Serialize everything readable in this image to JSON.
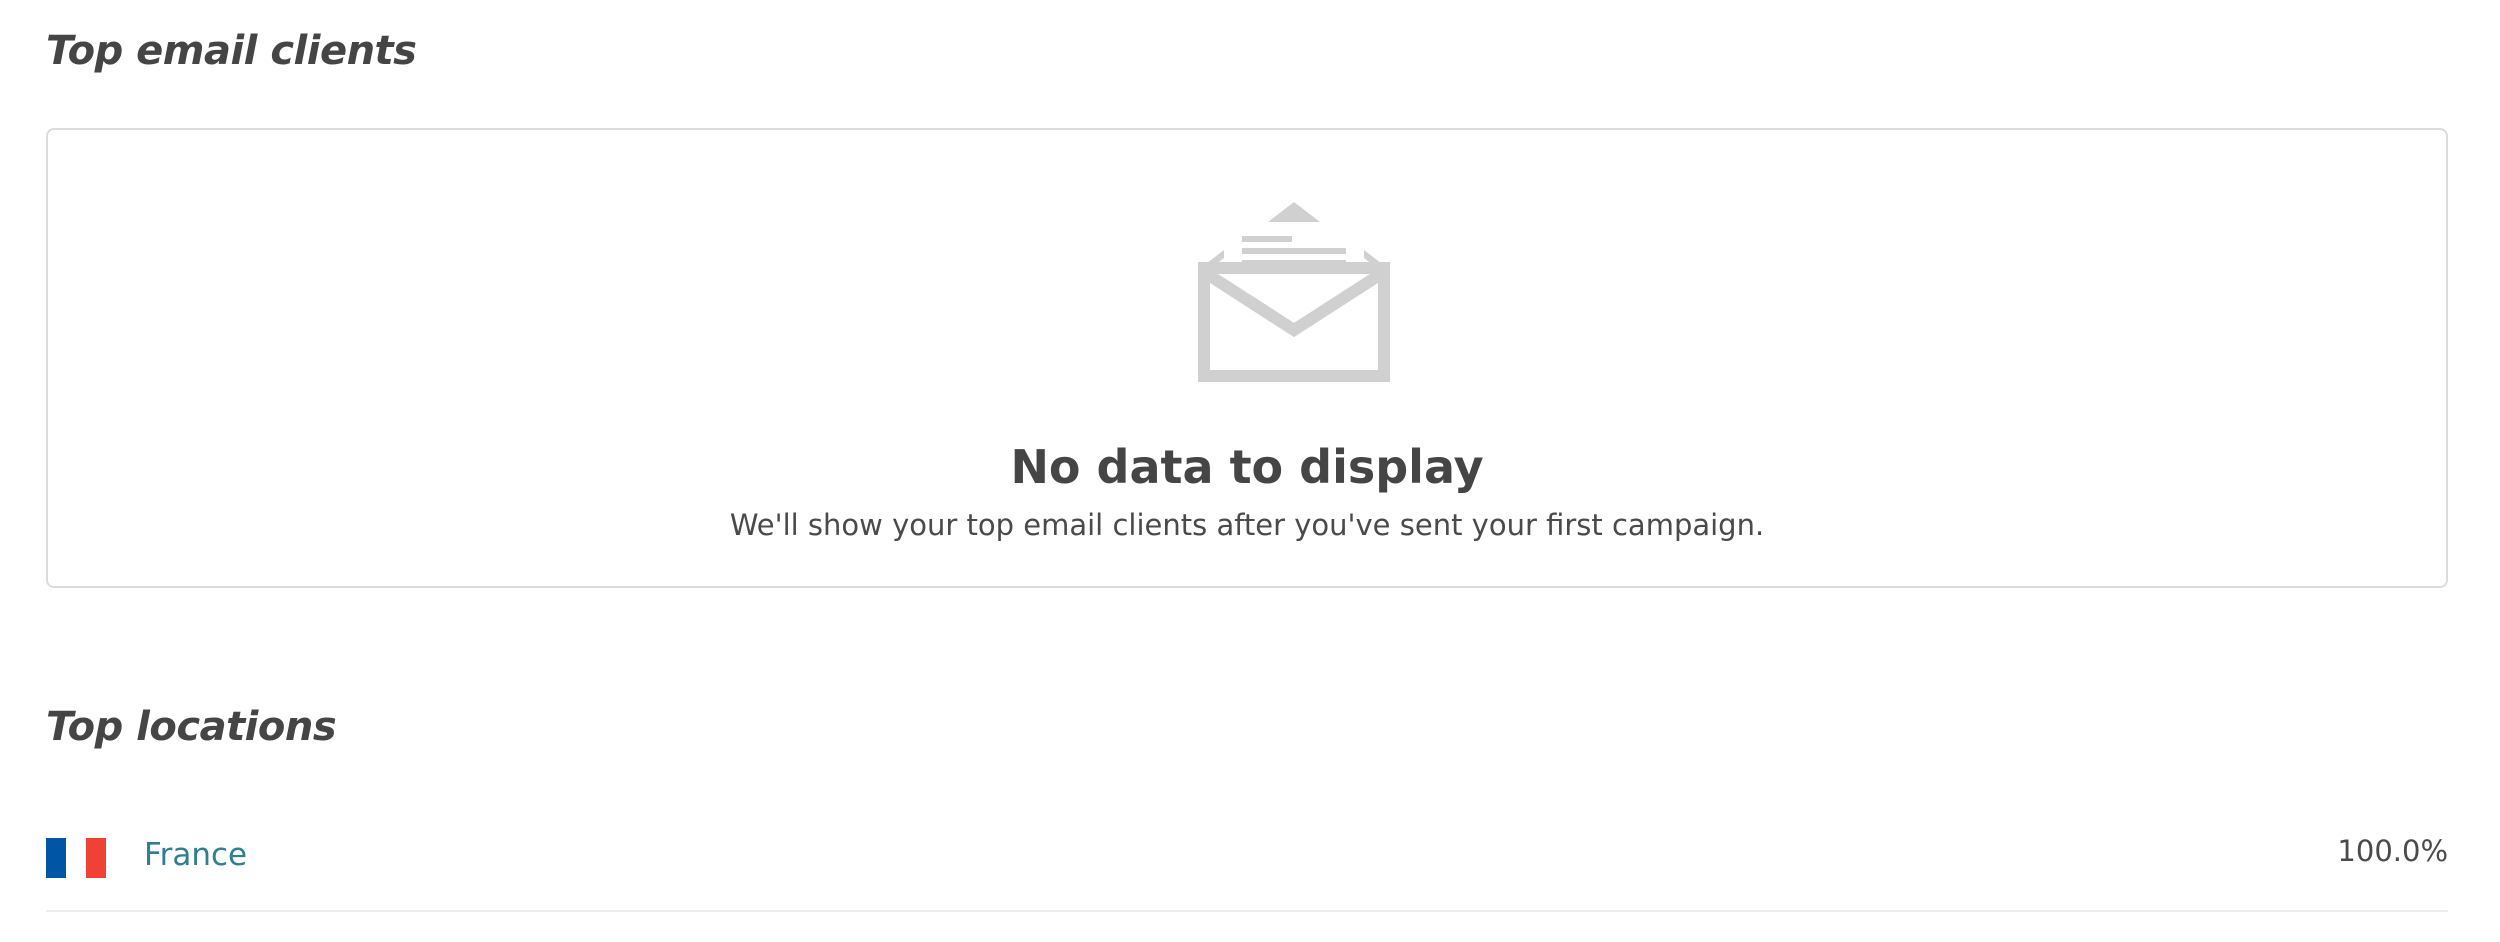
{
  "sections": {
    "email_clients": {
      "title": "Top email clients",
      "empty_state": {
        "icon": "open-envelope-icon",
        "heading": "No data to display",
        "message": "We'll show your top email clients after you've sent your first campaign."
      }
    },
    "locations": {
      "title": "Top locations",
      "items": [
        {
          "country": "France",
          "percentage": "100.0%",
          "flag_icon": "france-flag-icon",
          "flag_colors": [
            "#0055a4",
            "#ffffff",
            "#ef4135"
          ]
        }
      ]
    }
  },
  "colors": {
    "link": "#2f7f8f",
    "icon_gray": "#d0d0d0",
    "border": "#dcdcdc",
    "text": "#4a4a4a"
  }
}
